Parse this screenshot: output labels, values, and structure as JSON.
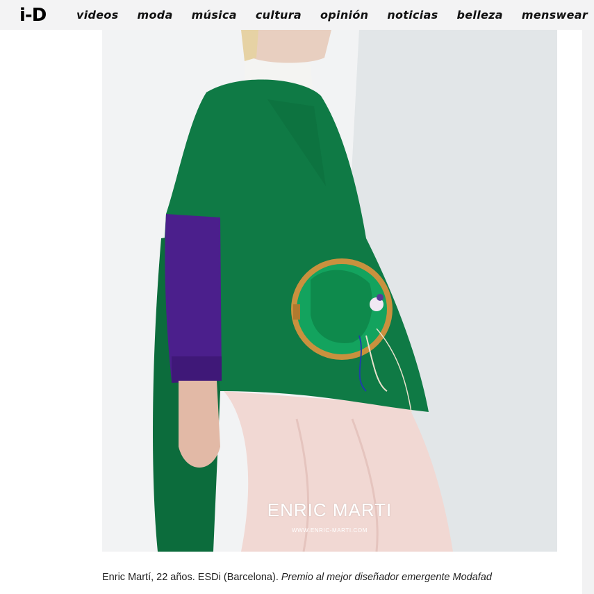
{
  "header": {
    "logo": "i-D",
    "nav": [
      {
        "label": "videos"
      },
      {
        "label": "moda"
      },
      {
        "label": "música"
      },
      {
        "label": "cultura"
      },
      {
        "label": "opinión"
      },
      {
        "label": "noticias"
      },
      {
        "label": "belleza"
      },
      {
        "label": "menswear"
      }
    ]
  },
  "photo": {
    "brand_text": "ENRIC MARTI",
    "url_text": "WWW.ENRIC-MARTI.COM"
  },
  "caption": {
    "plain": "Enric Martí, 22 años. ESDi (Barcelona).",
    "italic": "Premio al mejor diseñador emergente Modafad"
  },
  "colors": {
    "nav_bg": "#f3f3f4",
    "garment_green": "#0f7a45",
    "sleeve_purple": "#4b1f8c",
    "skirt_pink": "#f1d8d3",
    "hoop_wood": "#c9913e"
  }
}
